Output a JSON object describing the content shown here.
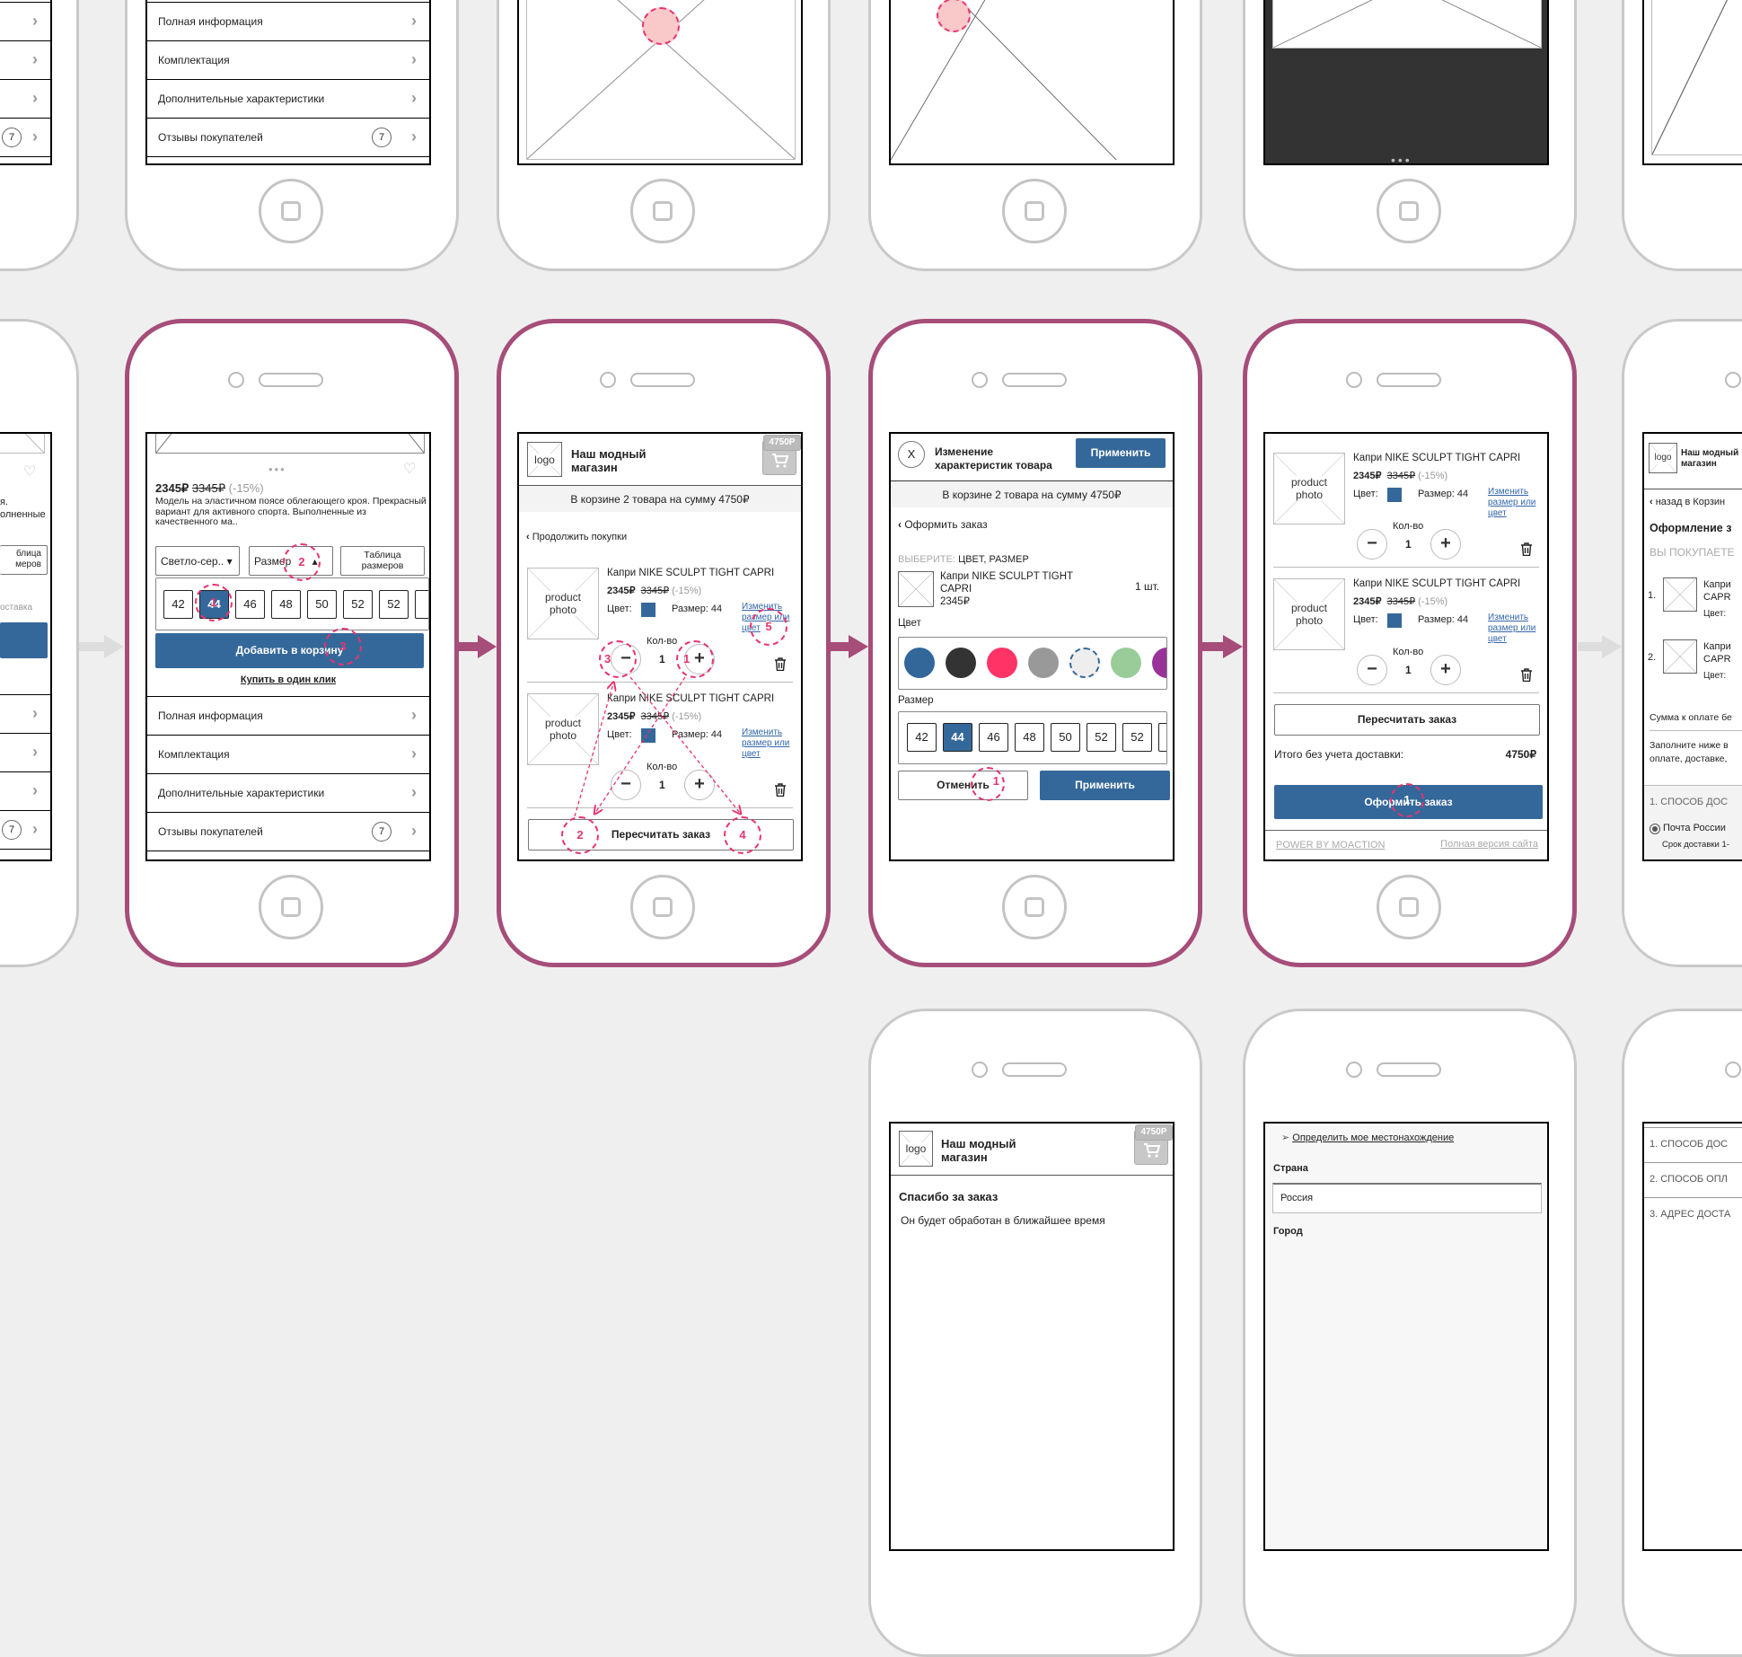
{
  "colors": {
    "accent": "#35689a",
    "highlight_frame": "#a64d79",
    "annotation": "#e8336e"
  },
  "product_list": {
    "rows": [
      "Полная информация",
      "Комплектация",
      "Дополнительные характеристики",
      "Отзывы покупателей"
    ],
    "reviews_count": "7",
    "chevron": "chevron-right-icon"
  },
  "product_page": {
    "price": "2345₽",
    "old_price": "3345₽",
    "discount": "(-15%)",
    "description": "Модель на эластичном поясе облегающего кроя. Прекрасный вариант для активного спорта. Выполненные из качественного ма..",
    "color_select": "Светло-сер..",
    "size_select": "Размер",
    "size_table": "Таблица размеров",
    "sizes": [
      "42",
      "44",
      "46",
      "48",
      "50",
      "52",
      "52"
    ],
    "selected_size": "44",
    "add_to_cart": "Добавить в корзину",
    "buy_one_click": "Купить в один клик"
  },
  "left_partial": {
    "t1": "я.",
    "t2": "олненные",
    "t3": "блица",
    "t4": "меров",
    "t5": "оставка",
    "badge": "7"
  },
  "shop": {
    "logo": "logo",
    "name_line1": "Наш модный",
    "name_line2": "магазин",
    "cart_badge": "4750Р"
  },
  "cart": {
    "summary": "В корзине 2 товара на сумму 4750₽",
    "continue": "Продолжить покупки",
    "items": [
      {
        "photo": "product photo",
        "title": "Капри NIKE SCULPT TIGHT CAPRI",
        "price": "2345₽",
        "old_price": "3345₽",
        "discount": "(-15%)",
        "color_label": "Цвет:",
        "color": "#35689a",
        "size_label": "Размер: 44",
        "change_link": "Изменить размер или цвет",
        "qty_label": "Кол-во",
        "qty": "1"
      },
      {
        "photo": "product photo",
        "title": "Капри NIKE SCULPT TIGHT CAPRI",
        "price": "2345₽",
        "old_price": "3345₽",
        "discount": "(-15%)",
        "color_label": "Цвет:",
        "color": "#35689a",
        "size_label": "Размер: 44",
        "change_link": "Изменить размер или цвет",
        "qty_label": "Кол-во",
        "qty": "1"
      }
    ],
    "recalc": "Пересчитать заказ",
    "total_label": "Итого без учета доставки:",
    "total_value": "4750₽",
    "order_button": "Оформить заказ",
    "footer_left": "POWER BY MOACTION",
    "footer_right": "Полная версия сайта"
  },
  "edit_dialog": {
    "close": "X",
    "title_line1": "Изменение",
    "title_line2": "характеристик товара",
    "apply": "Применить",
    "back": "Оформить заказ",
    "choose_prefix": "ВЫБЕРИТЕ:",
    "choose_value": "ЦВЕТ, РАЗМЕР",
    "product_line1": "Капри NIKE SCULPT TIGHT",
    "product_line2": "CAPRI",
    "product_price": "2345₽",
    "qty": "1 шт.",
    "color_label": "Цвет",
    "colors": [
      "#336699",
      "#333333",
      "#ff3366",
      "#999999",
      "#eeeeee",
      "#99cc99",
      "#993399"
    ],
    "selected_color": "#eeeeee",
    "size_label": "Размер",
    "cancel": "Отменить"
  },
  "checkout": {
    "back": "назад в Корзин",
    "title": "Оформление з",
    "buying": "ВЫ ПОКУПАЕТЕ",
    "items": [
      {
        "n": "1.",
        "l1": "Капри",
        "l2": "CAPR",
        "color": "Цвет:"
      },
      {
        "n": "2.",
        "l1": "Капри",
        "l2": "CAPR",
        "color": "Цвет:"
      }
    ],
    "sum": "Сумма к оплате бе",
    "fill1": "Заполните ниже в",
    "fill2": "оплате, доставке,",
    "step1": "1. СПОСОБ ДОС",
    "delivery": "Почта России",
    "term": "Срок доставки 1-"
  },
  "thanks": {
    "title": "Спасибо за заказ",
    "text": "Он будет обработан в ближайшее время"
  },
  "location": {
    "detect": "Определить мое местонахождение",
    "country_label": "Страна",
    "country_value": "Россия",
    "city_label": "Город"
  },
  "steps": [
    "1. СПОСОБ ДОС",
    "2. СПОСОБ ОПЛ",
    "3. АДРЕС ДОСТА"
  ],
  "annotations": {
    "p1": [
      "2",
      "1",
      "3"
    ],
    "p2": [
      "3",
      "1",
      "5",
      "2",
      "4"
    ],
    "p3": [
      "1"
    ],
    "p4": [
      "1"
    ]
  }
}
